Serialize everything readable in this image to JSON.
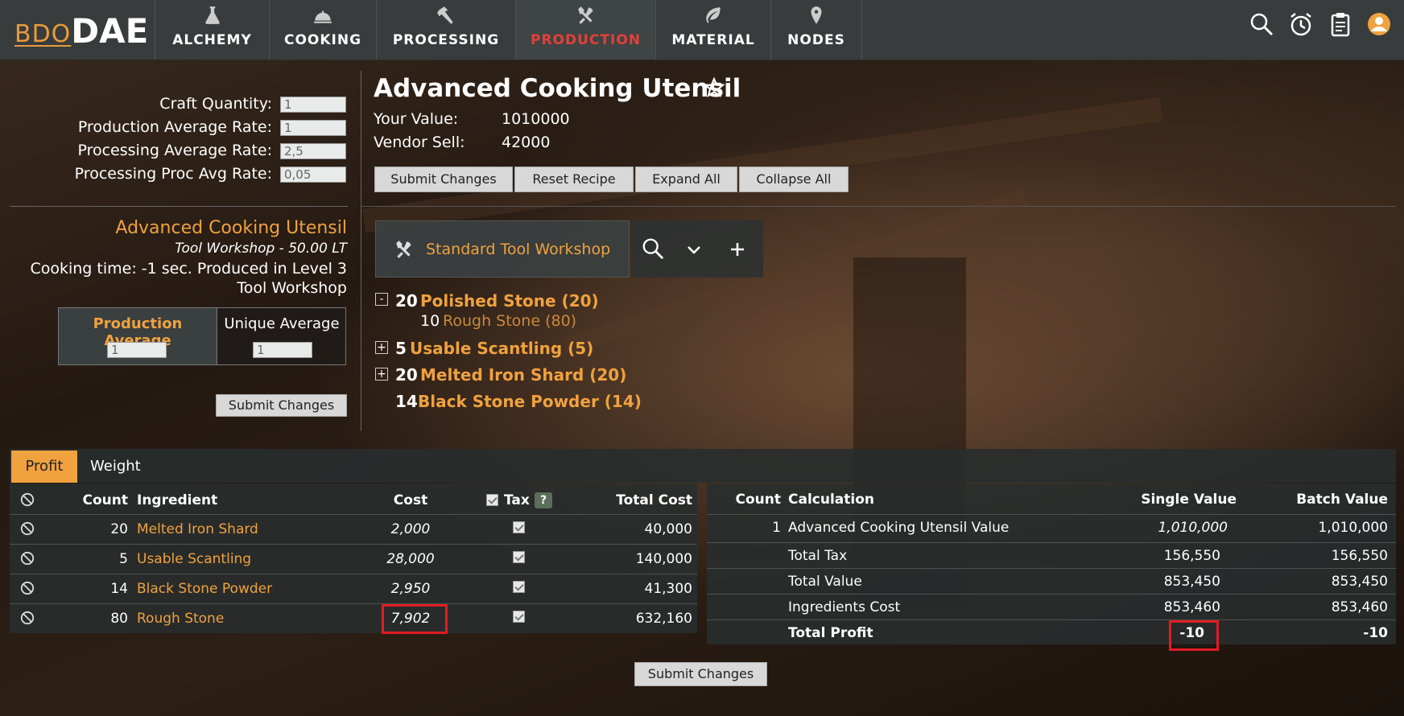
{
  "nav": {
    "logo_prefix": "BDO",
    "logo_main": "DAE",
    "items": [
      {
        "label": "ALCHEMY",
        "icon": "flask-icon"
      },
      {
        "label": "COOKING",
        "icon": "cloche-icon"
      },
      {
        "label": "PROCESSING",
        "icon": "hammer-icon"
      },
      {
        "label": "PRODUCTION",
        "icon": "tools-icon"
      },
      {
        "label": "MATERIAL",
        "icon": "leaf-icon"
      },
      {
        "label": "NODES",
        "icon": "map-pin-icon"
      }
    ],
    "active_color": "#e0413a",
    "right_icons": [
      "search-icon",
      "alarm-clock-icon",
      "clipboard-icon",
      "user-icon"
    ]
  },
  "settings": {
    "craft_quantity_label": "Craft Quantity:",
    "craft_quantity_value": "1",
    "production_avg_label": "Production Average Rate:",
    "production_avg_value": "1",
    "processing_avg_label": "Processing Average Rate:",
    "processing_avg_value": "2,5",
    "processing_proc_label": "Processing Proc Avg Rate:",
    "processing_proc_value": "0,05"
  },
  "recipe_info": {
    "name": "Advanced Cooking Utensil",
    "workshop": "Tool Workshop - 50.00 LT",
    "cooking_time": "Cooking time: -1 sec. Produced in Level 3 Tool Workshop",
    "production_average_label": "Production Average",
    "production_average_value": "1",
    "unique_average_label": "Unique Average",
    "unique_average_value": "1",
    "submit_label": "Submit Changes"
  },
  "item": {
    "title": "Advanced Cooking Utensil",
    "your_value_label": "Your Value:",
    "your_value": "1010000",
    "vendor_sell_label": "Vendor Sell:",
    "vendor_sell": "42000",
    "buttons": {
      "submit": "Submit Changes",
      "reset": "Reset Recipe",
      "expand": "Expand All",
      "collapse": "Collapse All"
    }
  },
  "workshop_selector": {
    "label": "Standard Tool Workshop"
  },
  "recipe_tree": [
    {
      "toggle": "-",
      "count": "20",
      "name": "Polished Stone (20)"
    },
    {
      "toggle": "",
      "count": "10",
      "name": "Rough Stone (80)",
      "child": true
    },
    {
      "toggle": "+",
      "count": "5",
      "name": "Usable Scantling (5)"
    },
    {
      "toggle": "+",
      "count": "20",
      "name": "Melted Iron Shard (20)"
    },
    {
      "toggle": "",
      "count": "14",
      "name": "Black Stone Powder (14)"
    }
  ],
  "tabs": {
    "profit": "Profit",
    "weight": "Weight"
  },
  "ingredients_table": {
    "headers": {
      "count": "Count",
      "ingredient": "Ingredient",
      "cost": "Cost",
      "tax": "Tax",
      "help": "?",
      "total_cost": "Total Cost"
    },
    "rows": [
      {
        "count": "20",
        "ingredient": "Melted Iron Shard",
        "cost": "2,000",
        "total_cost": "40,000"
      },
      {
        "count": "5",
        "ingredient": "Usable Scantling",
        "cost": "28,000",
        "total_cost": "140,000"
      },
      {
        "count": "14",
        "ingredient": "Black Stone Powder",
        "cost": "2,950",
        "total_cost": "41,300"
      },
      {
        "count": "80",
        "ingredient": "Rough Stone",
        "cost": "7,902",
        "total_cost": "632,160"
      }
    ]
  },
  "calc_table": {
    "headers": {
      "count": "Count",
      "calculation": "Calculation",
      "single": "Single Value",
      "batch": "Batch Value"
    },
    "rows": [
      {
        "count": "1",
        "calculation": "Advanced Cooking Utensil Value",
        "single": "1,010,000",
        "batch": "1,010,000"
      },
      {
        "count": "",
        "calculation": "Total Tax",
        "single": "156,550",
        "batch": "156,550"
      },
      {
        "count": "",
        "calculation": "Total Value",
        "single": "853,450",
        "batch": "853,450"
      },
      {
        "count": "",
        "calculation": "Ingredients Cost",
        "single": "853,460",
        "batch": "853,460"
      },
      {
        "count": "",
        "calculation": "Total Profit",
        "single": "-10",
        "batch": "-10"
      }
    ]
  },
  "bottom_submit": "Submit Changes",
  "colors": {
    "accent": "#f0a23f",
    "highlight": "#e21b23"
  }
}
